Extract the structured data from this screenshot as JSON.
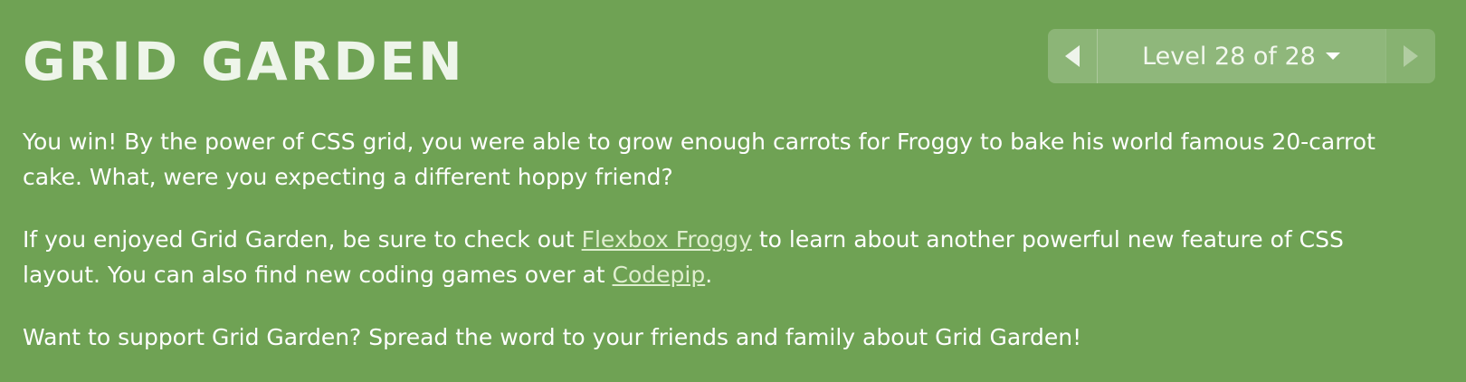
{
  "header": {
    "title": "GRID GARDEN"
  },
  "level_nav": {
    "label": "Level 28 of 28",
    "prev_icon": "triangle-left-icon",
    "next_icon": "triangle-right-icon",
    "dropdown_icon": "caret-down-icon"
  },
  "content": {
    "p1": "You win! By the power of CSS grid, you were able to grow enough carrots for Froggy to bake his world famous 20-carrot cake. What, were you expecting a different hoppy friend?",
    "p2": {
      "before": "If you enjoyed Grid Garden, be sure to check out ",
      "link1": "Flexbox Froggy",
      "middle": " to learn about another powerful new feature of CSS layout. You can also find new coding games over at ",
      "link2": "Codepip",
      "after": "."
    },
    "p3": "Want to support Grid Garden? Spread the word to your friends and family about Grid Garden!"
  },
  "colors": {
    "background": "#6fa254",
    "text": "#ffffff",
    "link": "#dfeecf"
  }
}
